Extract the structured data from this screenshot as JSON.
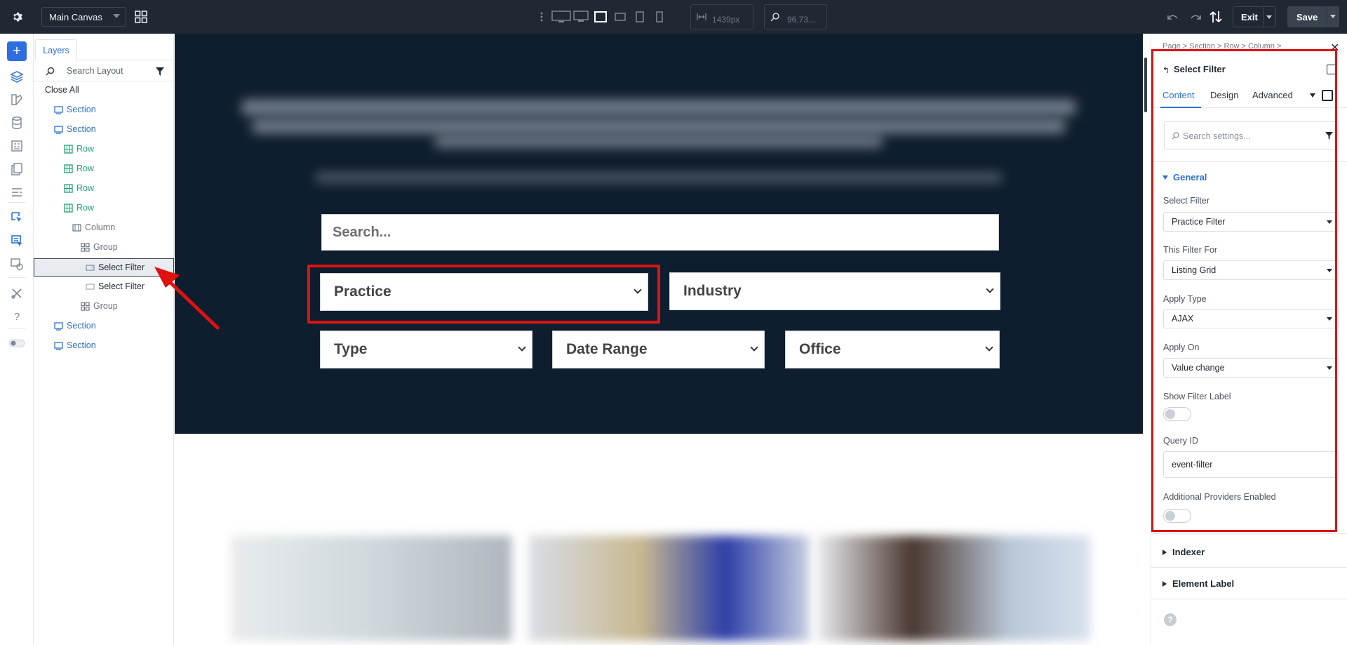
{
  "topbar": {
    "canvas_label": "Main Canvas",
    "width_value": "1439px",
    "zoom_value": "96.73...",
    "exit_label": "Exit",
    "save_label": "Save"
  },
  "layers": {
    "tab_label": "Layers",
    "search_placeholder": "Search Layout",
    "close_all": "Close All",
    "items": [
      {
        "label": "Section",
        "type": "section"
      },
      {
        "label": "Section",
        "type": "section"
      },
      {
        "label": "Row",
        "type": "row"
      },
      {
        "label": "Row",
        "type": "row"
      },
      {
        "label": "Row",
        "type": "row"
      },
      {
        "label": "Row",
        "type": "row"
      },
      {
        "label": "Column",
        "type": "column"
      },
      {
        "label": "Group",
        "type": "group"
      },
      {
        "label": "Select Filter",
        "type": "filter",
        "selected": true
      },
      {
        "label": "Select Filter",
        "type": "filter"
      },
      {
        "label": "Group",
        "type": "group"
      },
      {
        "label": "Section",
        "type": "section"
      },
      {
        "label": "Section",
        "type": "section"
      }
    ]
  },
  "canvas": {
    "search_placeholder": "Search...",
    "filters": {
      "practice": "Practice",
      "industry": "Industry",
      "type": "Type",
      "date_range": "Date Range",
      "office": "Office"
    }
  },
  "settings": {
    "breadcrumb": "Page > Section > Row > Column >",
    "title": "Select Filter",
    "tabs": {
      "content": "Content",
      "design": "Design",
      "advanced": "Advanced"
    },
    "search_placeholder": "Search settings...",
    "general_label": "General",
    "select_filter_label": "Select Filter",
    "select_filter_value": "Practice Filter",
    "filter_for_label": "This Filter For",
    "filter_for_value": "Listing Grid",
    "apply_type_label": "Apply Type",
    "apply_type_value": "AJAX",
    "apply_on_label": "Apply On",
    "apply_on_value": "Value change",
    "show_label_label": "Show Filter Label",
    "query_id_label": "Query ID",
    "query_id_value": "event-filter",
    "providers_label": "Additional Providers Enabled",
    "indexer_label": "Indexer",
    "element_label_label": "Element Label"
  },
  "colors": {
    "accent": "#2d6fe0",
    "topbar_bg": "#1f2833",
    "hero_bg": "#0f1e2e",
    "highlight": "#e01111",
    "section_text": "#2f6fc9",
    "row_text": "#22a37a"
  }
}
